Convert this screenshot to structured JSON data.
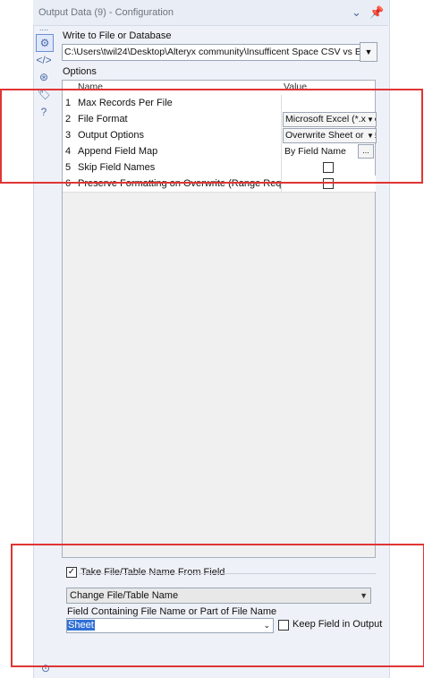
{
  "window": {
    "title": "Output Data (9) - Configuration"
  },
  "rail": {
    "dots": "...."
  },
  "write": {
    "label": "Write to File or Database",
    "path": "C:\\Users\\twil24\\Desktop\\Alteryx community\\Insufficent Space CSV vs Excel\\M"
  },
  "options": {
    "label": "Options",
    "header_name": "Name",
    "header_value": "Value",
    "rows": [
      {
        "num": "1",
        "name": "Max Records Per File",
        "value": ""
      },
      {
        "num": "2",
        "name": "File Format",
        "value": "Microsoft Excel (*.xlsx"
      },
      {
        "num": "3",
        "name": "Output Options",
        "value": "Overwrite Sheet or Ra"
      },
      {
        "num": "4",
        "name": "Append Field Map",
        "value": "By Field Name"
      },
      {
        "num": "5",
        "name": "Skip Field Names",
        "value": ""
      },
      {
        "num": "6",
        "name": "Preserve Formatting on Overwrite (Range Required)",
        "value": ""
      }
    ]
  },
  "take": {
    "label": "Take File/Table Name From Field",
    "mode": "Change File/Table Name",
    "field_label": "Field Containing File Name or Part of File Name",
    "field_value": "Sheet",
    "keep_label": "Keep Field in Output"
  },
  "colors": {
    "highlight": "#e03535",
    "accent": "#4a6aa6"
  }
}
